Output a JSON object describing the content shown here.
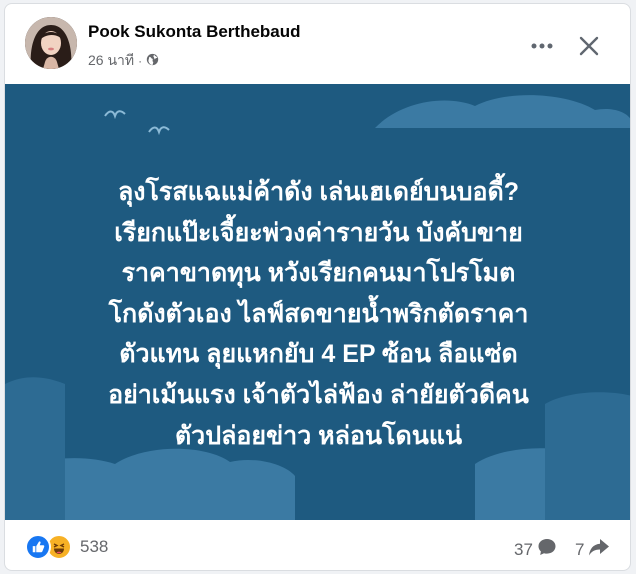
{
  "post": {
    "author_name": "Pook Sukonta Berthebaud",
    "timestamp": "26 นาที",
    "separator": "·",
    "privacy_icon": "globe-icon",
    "more_icon": "more-horizontal-icon",
    "close_icon": "close-icon"
  },
  "image": {
    "background_color": "#1e5a80",
    "text_color": "#ffffff",
    "headline_lines": [
      "ลุงโรสแฉแม่ค้าดัง เล่นเฮเดย์บนบอดี้?",
      "เรียกแป๊ะเจี้ยะพ่วงค่ารายวัน บังคับขาย",
      "ราคาขาดทุน หวังเรียกคนมาโปรโมต",
      "โกดังตัวเอง ไลฟ์สดขายน้ำพริกตัดราคา",
      "ตัวแทน ลุยแหกยับ 4 EP ซ้อน ลือแซ่ด",
      "อย่าเม้นแรง เจ้าตัวไล่ฟ้อง ล่ายัยตัวดีคน",
      "ตัวปล่อยข่าว หล่อนโดนแน่"
    ]
  },
  "footer": {
    "reaction_icons": [
      "like-icon",
      "haha-icon"
    ],
    "reaction_count": "538",
    "comment_count": "37",
    "comment_icon": "comment-icon",
    "share_count": "7",
    "share_icon": "share-icon",
    "accent_color": "#1877f2"
  }
}
